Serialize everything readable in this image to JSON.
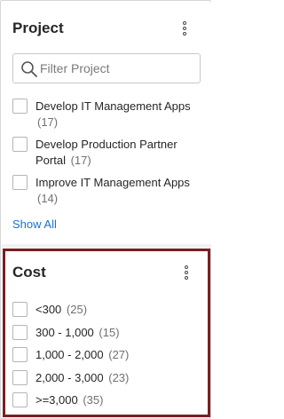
{
  "project": {
    "title": "Project",
    "search": {
      "placeholder": "Filter Project",
      "value": ""
    },
    "items": [
      {
        "label": "Develop IT Management Apps",
        "count": "(17)",
        "checked": false
      },
      {
        "label": "Develop Production Partner Portal",
        "count": "(17)",
        "checked": false
      },
      {
        "label": "Improve IT Management Apps",
        "count": "(14)",
        "checked": false
      }
    ],
    "show_all_label": "Show All"
  },
  "cost": {
    "title": "Cost",
    "items": [
      {
        "label": "<300",
        "count": "(25)",
        "checked": false
      },
      {
        "label": "300 - 1,000",
        "count": "(15)",
        "checked": false
      },
      {
        "label": "1,000 - 2,000",
        "count": "(27)",
        "checked": false
      },
      {
        "label": "2,000 - 3,000",
        "count": "(23)",
        "checked": false
      },
      {
        "label": ">=3,000",
        "count": "(35)",
        "checked": false
      }
    ]
  },
  "colors": {
    "link": "#1a73c9",
    "highlight_border": "#7a1f22",
    "divider": "#f2f2f2"
  },
  "icons": {
    "search": "search-icon",
    "menu": "kebab-vertical-icon"
  }
}
